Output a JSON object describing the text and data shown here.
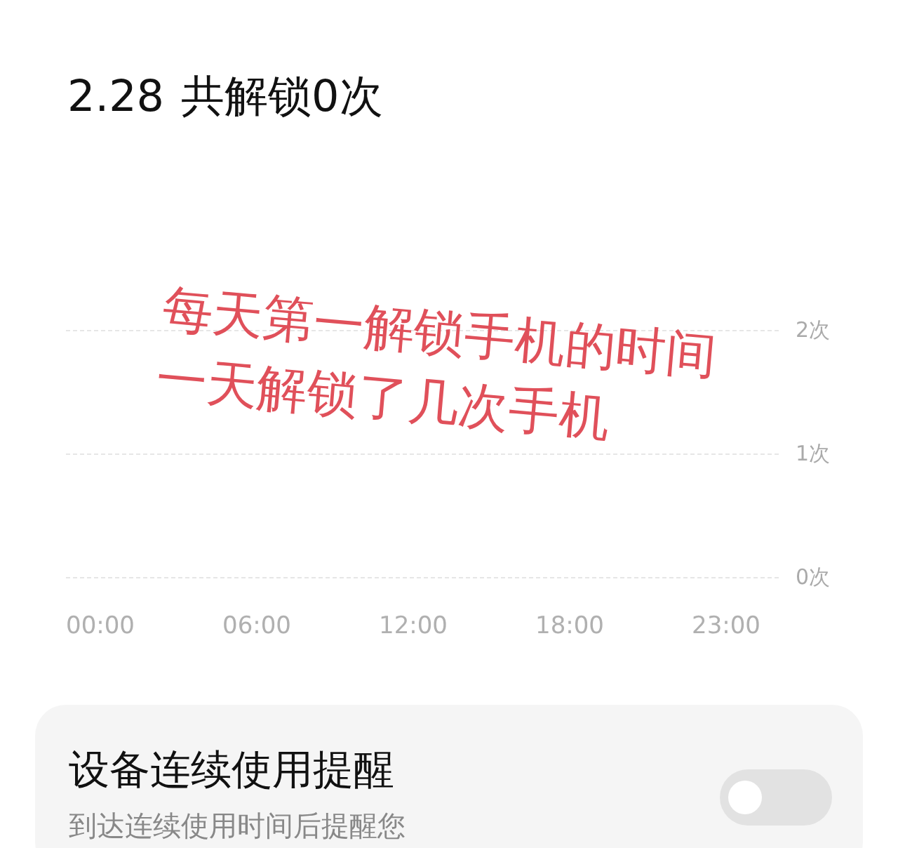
{
  "header": {
    "date": "2.28",
    "summary": "共解锁0次"
  },
  "chart": {
    "y_labels": [
      "2次",
      "1次",
      "0次"
    ],
    "x_labels": [
      "00:00",
      "06:00",
      "12:00",
      "18:00",
      "23:00"
    ]
  },
  "annotation": {
    "lines": [
      "每天第一解锁手机的时间",
      "一天解锁了几次手机"
    ]
  },
  "reminder_card": {
    "title": "设备连续使用提醒",
    "subtitle": "到达连续使用时间后提醒您",
    "on": false
  }
}
